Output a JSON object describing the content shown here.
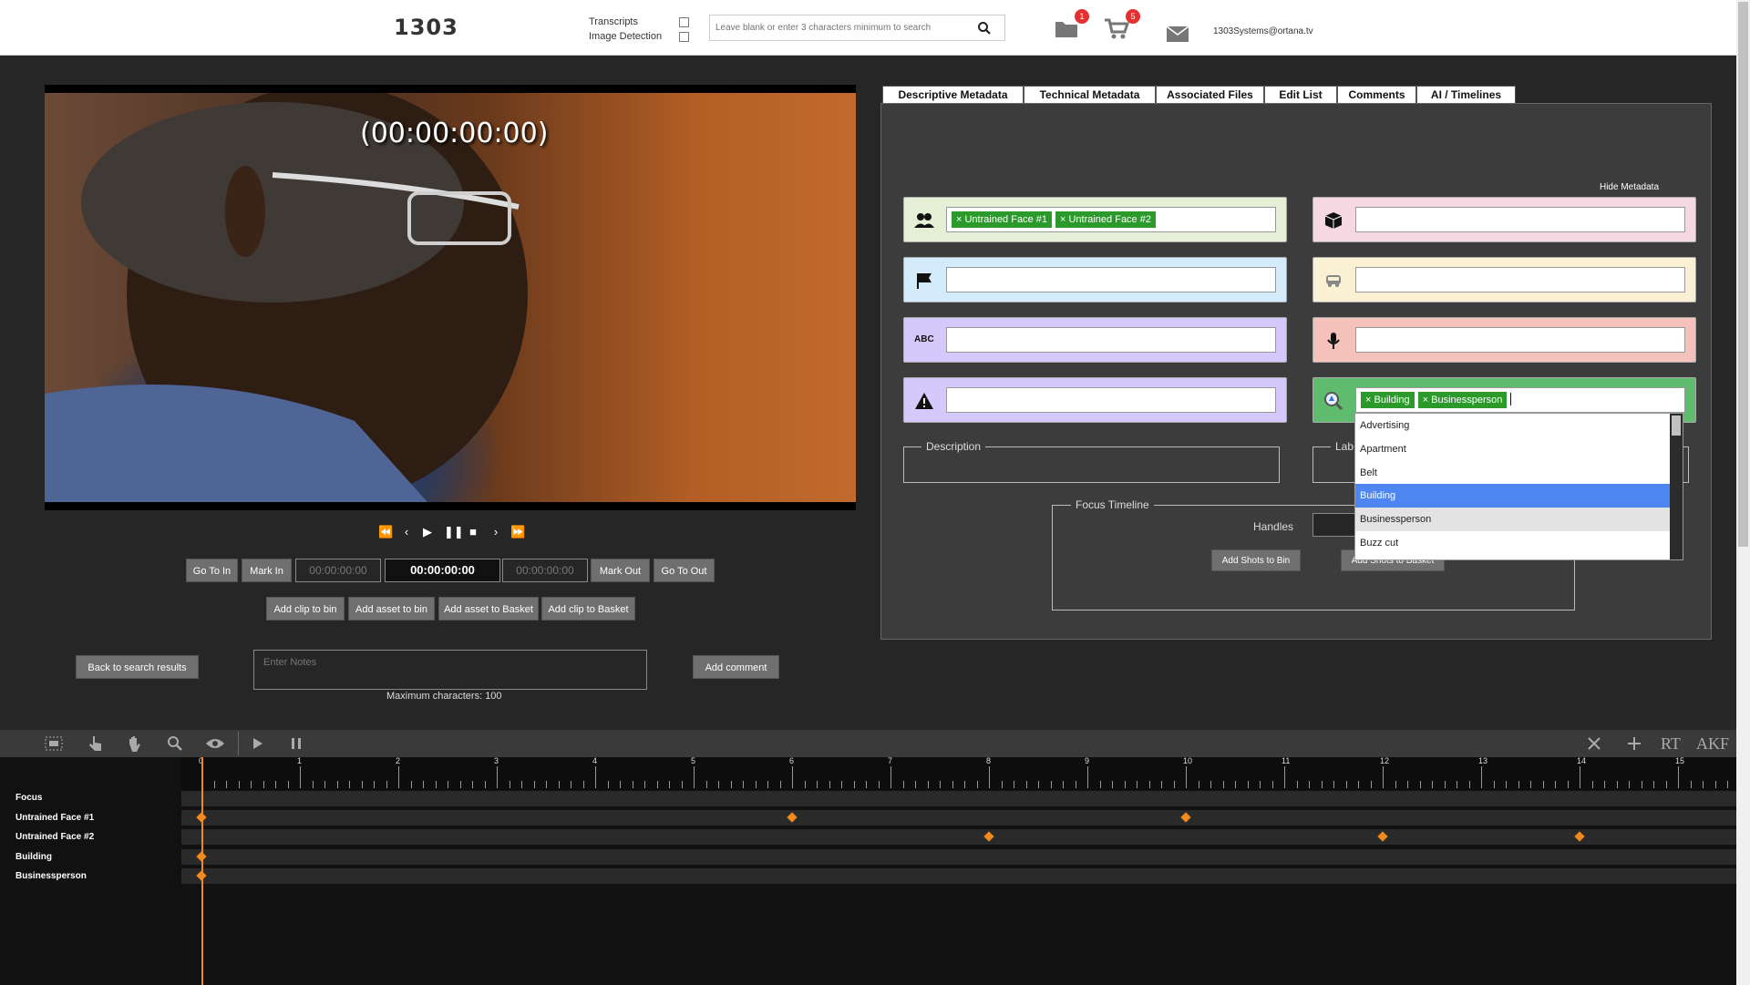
{
  "header": {
    "logo": "1303",
    "transcripts_label": "Transcripts",
    "image_detection_label": "Image Detection",
    "search_placeholder": "Leave blank or enter 3 characters minimum to search",
    "folder_badge": "1",
    "cart_badge": "5",
    "email": "1303Systems@ortana.tv"
  },
  "player": {
    "timecode_overlay": "(00:00:00:00)",
    "go_to_in": "Go To In",
    "mark_in": "Mark In",
    "in_point": "00:00:00:00",
    "current_time": "00:00:00:00",
    "out_point": "00:00:00:00",
    "mark_out": "Mark Out",
    "go_to_out": "Go To Out",
    "add_clip_to_bin": "Add clip to bin",
    "add_asset_to_bin": "Add asset to bin",
    "add_asset_to_basket": "Add asset to Basket",
    "add_clip_to_basket": "Add clip to Basket",
    "back_to_search": "Back to search results",
    "notes_placeholder": "Enter Notes",
    "add_comment": "Add comment",
    "max_chars": "Maximum characters: 100"
  },
  "tabs": [
    "Descriptive Metadata",
    "Technical Metadata",
    "Associated Files",
    "Edit List",
    "Comments",
    "AI / Timelines"
  ],
  "panel": {
    "hide_metadata": "Hide Metadata",
    "faces_tags": [
      "Untrained Face #1",
      "Untrained Face #2"
    ],
    "labels_tags": [
      "Building",
      "Businessperson"
    ],
    "text_icon_label": "ABC",
    "description_legend": "Description",
    "labels_legend": "Lab",
    "focus_timeline_legend": "Focus Timeline",
    "handles_label": "Handles",
    "add_shots_to_bin": "Add Shots to Bin",
    "add_shots_to_basket": "Add Shots to Basket",
    "colors": {
      "faces": "#e5efd5",
      "places": "#d3ebfa",
      "text": "#d5c8fa",
      "warning": "#d5c8fa",
      "objects": "#f6d8e2",
      "vehicles": "#faf1d4",
      "audio": "#f4c2ba",
      "labels": "#5fbb6e"
    }
  },
  "dropdown": {
    "options": [
      "Advertising",
      "Apartment",
      "Belt",
      "Building",
      "Businessperson",
      "Buzz cut"
    ],
    "selected": "Building",
    "hovered": "Businessperson"
  },
  "timeline": {
    "tracks": [
      "Focus",
      "Untrained Face #1",
      "Untrained Face #2",
      "Building",
      "Businessperson"
    ],
    "ruler_labels": [
      "0",
      "1",
      "2",
      "3",
      "4",
      "5",
      "6",
      "7",
      "8",
      "9",
      "10",
      "11",
      "12",
      "13",
      "14",
      "15"
    ],
    "markers": {
      "Untrained Face #1": [
        0,
        6,
        10
      ],
      "Untrained Face #2": [
        8,
        12,
        14
      ],
      "Building": [
        0
      ],
      "Businessperson": [
        0
      ]
    },
    "right_tools": [
      "RT",
      "AKF"
    ]
  }
}
